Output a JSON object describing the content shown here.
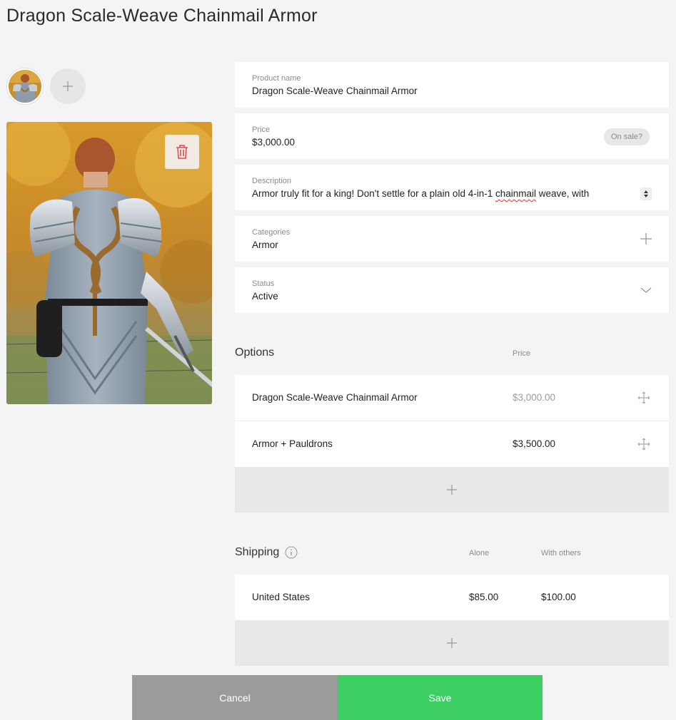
{
  "page": {
    "title": "Dragon Scale-Weave Chainmail Armor"
  },
  "images": {
    "thumb_icon": "armor-thumbnail",
    "add_icon": "plus-icon",
    "delete_icon": "trash-icon"
  },
  "fields": {
    "name": {
      "label": "Product name",
      "value": "Dragon Scale-Weave Chainmail Armor"
    },
    "price": {
      "label": "Price",
      "value": "$3,000.00",
      "sale_label": "On sale?"
    },
    "description": {
      "label": "Description",
      "value_start": "Armor truly fit for a king! Don't settle for a plain old 4-in-1 ",
      "value_misspelled": "chainmail",
      "value_end": " weave, with"
    },
    "categories": {
      "label": "Categories",
      "value": "Armor"
    },
    "status": {
      "label": "Status",
      "value": "Active"
    }
  },
  "options": {
    "title": "Options",
    "price_header": "Price",
    "rows": [
      {
        "name": "Dragon Scale-Weave Chainmail Armor",
        "price": "$3,000.00"
      },
      {
        "name": "Armor + Pauldrons",
        "price": "$3,500.00"
      }
    ]
  },
  "shipping": {
    "title": "Shipping",
    "alone_header": "Alone",
    "others_header": "With others",
    "rows": [
      {
        "country": "United States",
        "alone": "$85.00",
        "others": "$100.00"
      }
    ]
  },
  "actions": {
    "cancel": "Cancel",
    "save": "Save"
  },
  "colors": {
    "save": "#3ecf62",
    "cancel": "#9b9b9b",
    "delete": "#e14b4b",
    "background": "#f4f4f4"
  }
}
